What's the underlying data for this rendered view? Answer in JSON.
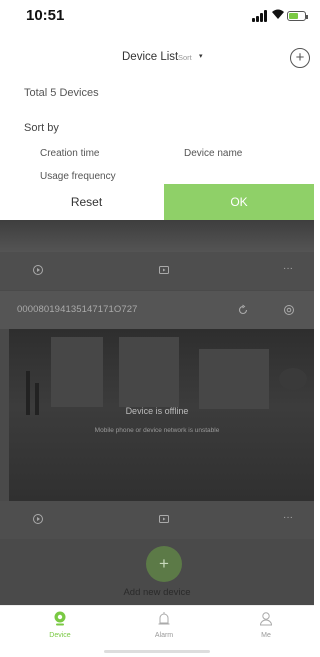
{
  "status_bar": {
    "time": "10:51"
  },
  "nav": {
    "title": "Device List",
    "sort_label": "Sort",
    "sort_caret": "▾",
    "add_glyph": "+"
  },
  "sort_panel": {
    "total": "Total 5 Devices",
    "sort_by": "Sort by",
    "options": [
      "Creation time",
      "Device name",
      "Usage frequency"
    ],
    "reset": "Reset",
    "ok": "OK"
  },
  "device": {
    "id": "000080194135147171O727",
    "offline_title": "Device is offline",
    "offline_sub": "Mobile phone or device network is unstable"
  },
  "controls": {
    "replay_icon": "replay-icon",
    "video_icon": "video-icon",
    "more": "···"
  },
  "add_device": {
    "fab": "+",
    "label": "Add new device"
  },
  "tabs": [
    {
      "label": "Device",
      "icon": "camera-icon",
      "active": true
    },
    {
      "label": "Alarm",
      "icon": "alarm-icon",
      "active": false
    },
    {
      "label": "Me",
      "icon": "person-icon",
      "active": false
    }
  ],
  "colors": {
    "accent": "#8fd068",
    "tab_active": "#7ac943",
    "content_overlay": "#4a4a4a"
  }
}
